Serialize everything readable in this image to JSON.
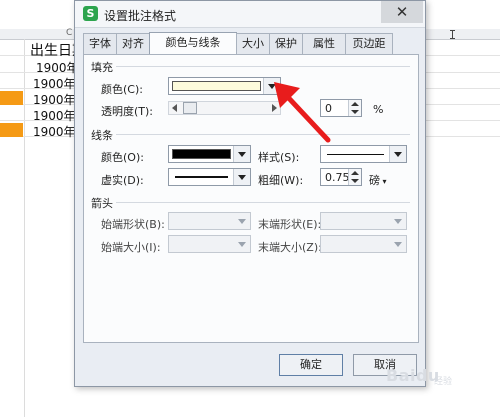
{
  "sheet": {
    "column_header": "出生日期",
    "column_letter": "C",
    "rows": [
      "1900年",
      "1900年",
      "1900年",
      "1900年",
      "1900年"
    ]
  },
  "dialog": {
    "title": "设置批注格式",
    "app_icon_glyph": "S",
    "close_glyph": "✕",
    "tabs": [
      "字体",
      "对齐",
      "颜色与线条",
      "大小",
      "保护",
      "属性",
      "页边距"
    ],
    "active_tab": "颜色与线条",
    "fill": {
      "group_label": "填充",
      "color_label": "颜色(C):",
      "color_value": "#fdfbdc",
      "transparency_label": "透明度(T):",
      "transparency_value": "0",
      "transparency_unit": "%"
    },
    "line": {
      "group_label": "线条",
      "color_label": "颜色(O):",
      "color_value": "#000000",
      "style_label": "样式(S):",
      "dash_label": "虚实(D):",
      "weight_label": "粗细(W):",
      "weight_value": "0.75",
      "weight_unit": "磅"
    },
    "arrows": {
      "group_label": "箭头",
      "begin_style_label": "始端形状(B):",
      "end_style_label": "末端形状(E):",
      "begin_size_label": "始端大小(I):",
      "end_size_label": "末端大小(Z):"
    },
    "ok_label": "确定",
    "cancel_label": "取消"
  },
  "watermark": {
    "text": "Baidu",
    "sub": "经验"
  },
  "colors": {
    "annotation_arrow": "#e81c1c",
    "row_highlight": "#f59a15"
  }
}
